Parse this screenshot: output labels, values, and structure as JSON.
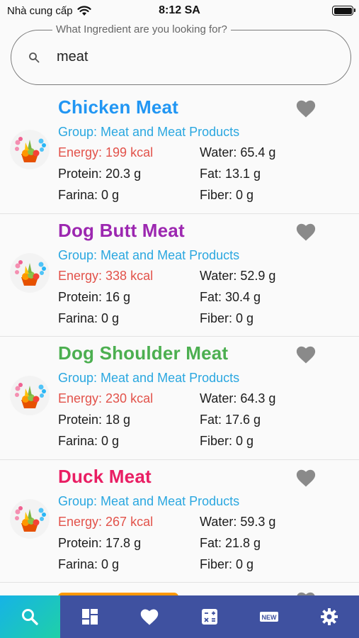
{
  "status_bar": {
    "carrier": "Nhà cung cấp",
    "time": "8:12 SA"
  },
  "search": {
    "label": "What Ingredient are you looking for?",
    "value": "meat"
  },
  "labels": {
    "group": "Group:",
    "energy": "Energy:",
    "water": "Water:",
    "protein": "Protein:",
    "fat": "Fat:",
    "farina": "Farina:",
    "fiber": "Fiber:"
  },
  "items": [
    {
      "name": "Chicken Meat",
      "name_color": "#2196f3",
      "group": "Meat and Meat Products",
      "energy": "199 kcal",
      "water": "65.4 g",
      "protein": "20.3 g",
      "fat": "13.1 g",
      "farina": "0 g",
      "fiber": "0 g"
    },
    {
      "name": "Dog Butt Meat",
      "name_color": "#9c27b0",
      "group": "Meat and Meat Products",
      "energy": "338 kcal",
      "water": "52.9 g",
      "protein": "16 g",
      "fat": "30.4 g",
      "farina": "0 g",
      "fiber": "0 g"
    },
    {
      "name": "Dog Shoulder Meat",
      "name_color": "#4caf50",
      "group": "Meat and Meat Products",
      "energy": "230 kcal",
      "water": "64.3 g",
      "protein": "18 g",
      "fat": "17.6 g",
      "farina": "0 g",
      "fiber": "0 g"
    },
    {
      "name": "Duck Meat",
      "name_color": "#e91e63",
      "group": "Meat and Meat Products",
      "energy": "267 kcal",
      "water": "59.3 g",
      "protein": "17.8 g",
      "fat": "21.8 g",
      "farina": "0 g",
      "fiber": "0 g"
    }
  ],
  "partial_item_color": "#ff9800",
  "nav": {
    "tabs": [
      "search-icon",
      "dashboard-icon",
      "heart-icon",
      "calculator-icon",
      "new-badge-icon",
      "gear-icon"
    ],
    "active_index": 0,
    "new_badge_text": "NEW"
  },
  "colors": {
    "accent": "#3f51a0",
    "group_text": "#2aa7e0",
    "energy_text": "#e2524a",
    "heart": "#8a8a8a"
  }
}
